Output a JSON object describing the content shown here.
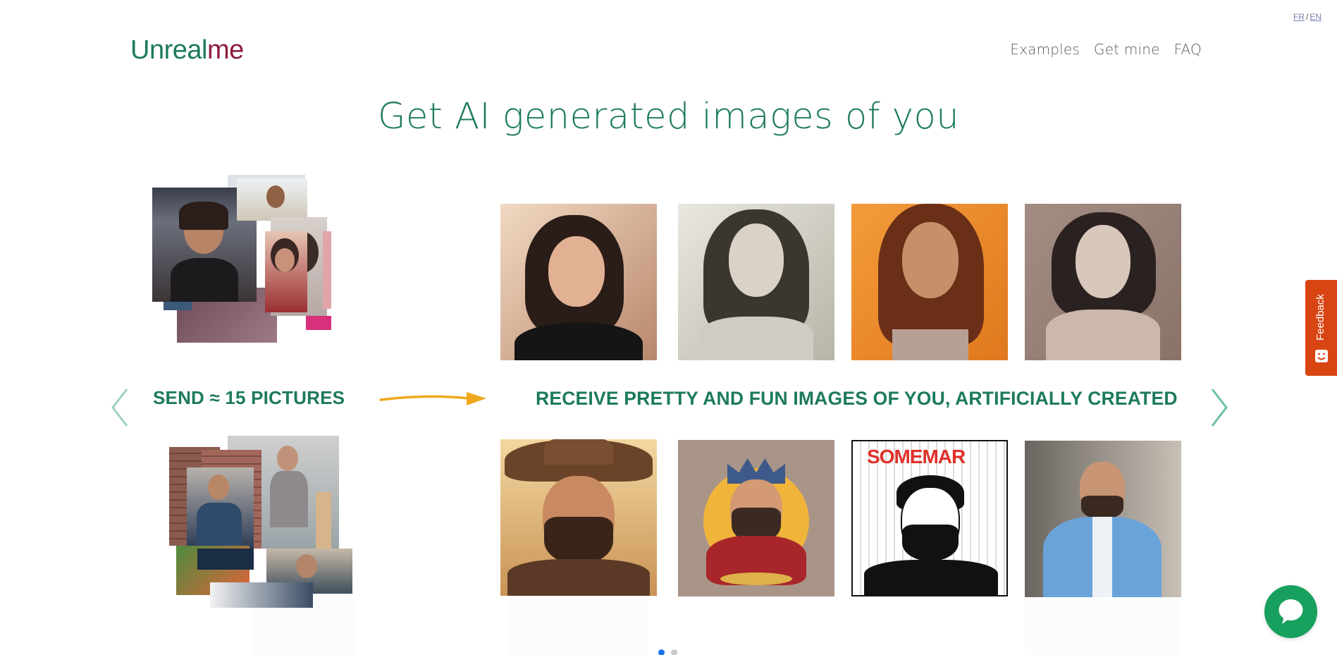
{
  "language": {
    "fr": "FR",
    "separator": "/",
    "en": "EN"
  },
  "brand": {
    "part1": "Unreal",
    "part2": "me"
  },
  "nav": {
    "items": [
      "Examples",
      "Get mine",
      "FAQ"
    ]
  },
  "hero": {
    "headline": "Get AI generated images of you"
  },
  "slider": {
    "send_caption": "SEND ≈ 15 PICTURES",
    "receive_caption": "RECEIVE PRETTY AND FUN IMAGES OF YOU, ARTIFICIALLY CREATED",
    "dots_count": 2,
    "active_dot": 0,
    "top_row_portraits": [
      "woman-studio-portrait",
      "woman-sketch-portrait",
      "woman-orange-portrait",
      "woman-pencil-portrait"
    ],
    "bottom_row_portraits": [
      "man-cowboy-portrait",
      "man-king-illustration",
      "man-comic-portrait",
      "man-blue-suit-portrait"
    ],
    "comic_title": "SOMEMAR"
  },
  "feedback": {
    "label": "Feedback"
  },
  "colors": {
    "brand_green": "#1d7a5e",
    "brand_red": "#8b1d3c",
    "feedback_orange": "#d94413",
    "chat_green": "#18a05e",
    "active_dot": "#1a73e8"
  }
}
